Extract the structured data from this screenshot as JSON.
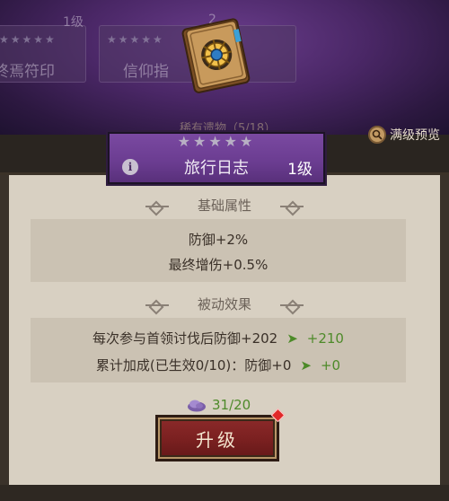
{
  "background": {
    "card_left": {
      "stars": "★★★★★",
      "name": "终焉符印",
      "level": "1级"
    },
    "card_right": {
      "stars": "★★★★★",
      "name": "信仰指",
      "level": "2"
    },
    "collection_text": "稀有遗物（5/18）"
  },
  "preview": {
    "label": "满级预览"
  },
  "banner": {
    "stars": "★★★★★",
    "name": "旅行日志",
    "level": "1级",
    "info_glyph": "i"
  },
  "base_stats": {
    "header": "基础属性",
    "lines": [
      "防御+2%",
      "最终增伤+0.5%"
    ]
  },
  "passive": {
    "header": "被动效果",
    "lines": [
      {
        "text": "每次参与首领讨伐后防御+202",
        "arrow": "➤",
        "value": "+210"
      },
      {
        "text": "累计加成(已生效0/10)：防御+0",
        "arrow": "➤",
        "value": "+0"
      }
    ]
  },
  "cost": {
    "value": "31/20"
  },
  "upgrade": {
    "label": "升级"
  },
  "colors": {
    "purple": "#6a3c90",
    "panel": "#d8d0c2",
    "green": "#4e8a2a",
    "button_red": "#7a2020"
  }
}
